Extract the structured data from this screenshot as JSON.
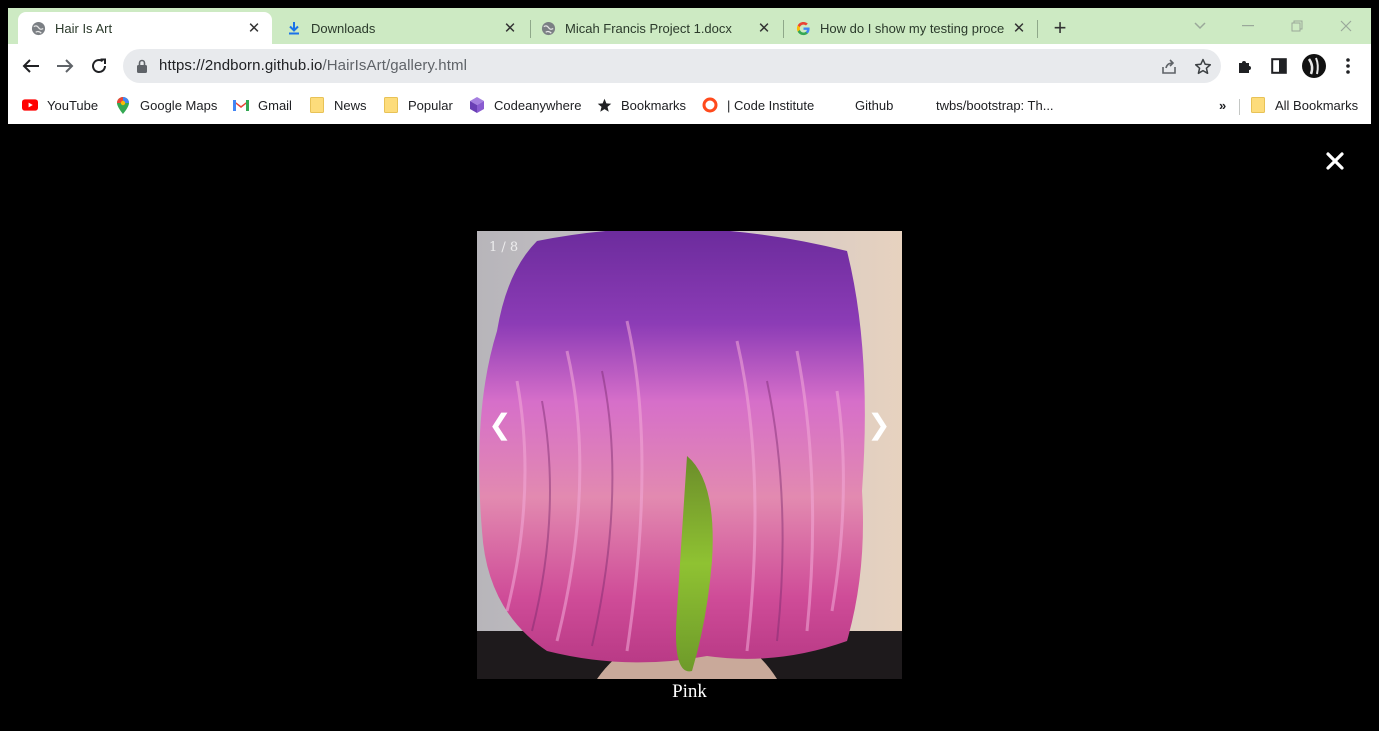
{
  "browser": {
    "tabs": [
      {
        "title": "Hair Is Art",
        "active": true,
        "favicon": "globe-icon"
      },
      {
        "title": "Downloads",
        "active": false,
        "favicon": "download-icon"
      },
      {
        "title": "Micah Francis Project 1.docx",
        "active": false,
        "favicon": "globe-icon"
      },
      {
        "title": "How do I show my testing proce",
        "active": false,
        "favicon": "google-icon"
      }
    ],
    "close_glyph": "✕",
    "new_tab_glyph": "+",
    "address": {
      "host": "https://2ndborn.github.io",
      "path": "/HairIsArt/gallery.html"
    },
    "bookmarks": [
      {
        "label": "YouTube",
        "icon": "youtube-icon"
      },
      {
        "label": "Google Maps",
        "icon": "maps-pin-icon"
      },
      {
        "label": "Gmail",
        "icon": "gmail-icon"
      },
      {
        "label": "News",
        "icon": "folder-icon"
      },
      {
        "label": "Popular",
        "icon": "folder-icon"
      },
      {
        "label": "Codeanywhere",
        "icon": "cube-icon"
      },
      {
        "label": "Bookmarks",
        "icon": "star-icon"
      },
      {
        "label": "| Code Institute",
        "icon": "ring-icon"
      },
      {
        "label": "Github",
        "icon": "none"
      },
      {
        "label": "twbs/bootstrap: Th...",
        "icon": "none"
      }
    ],
    "overflow_label": "»",
    "all_bookmarks_label": "All Bookmarks",
    "colors": {
      "tabstrip": "#cdeac3",
      "active_tab": "#ffffff",
      "omnibox": "#e8eaed"
    }
  },
  "lightbox": {
    "counter": "1 / 8",
    "caption": "Pink",
    "prev_glyph": "❮",
    "next_glyph": "❯",
    "background": "#000000",
    "close_icon": "close-icon"
  }
}
